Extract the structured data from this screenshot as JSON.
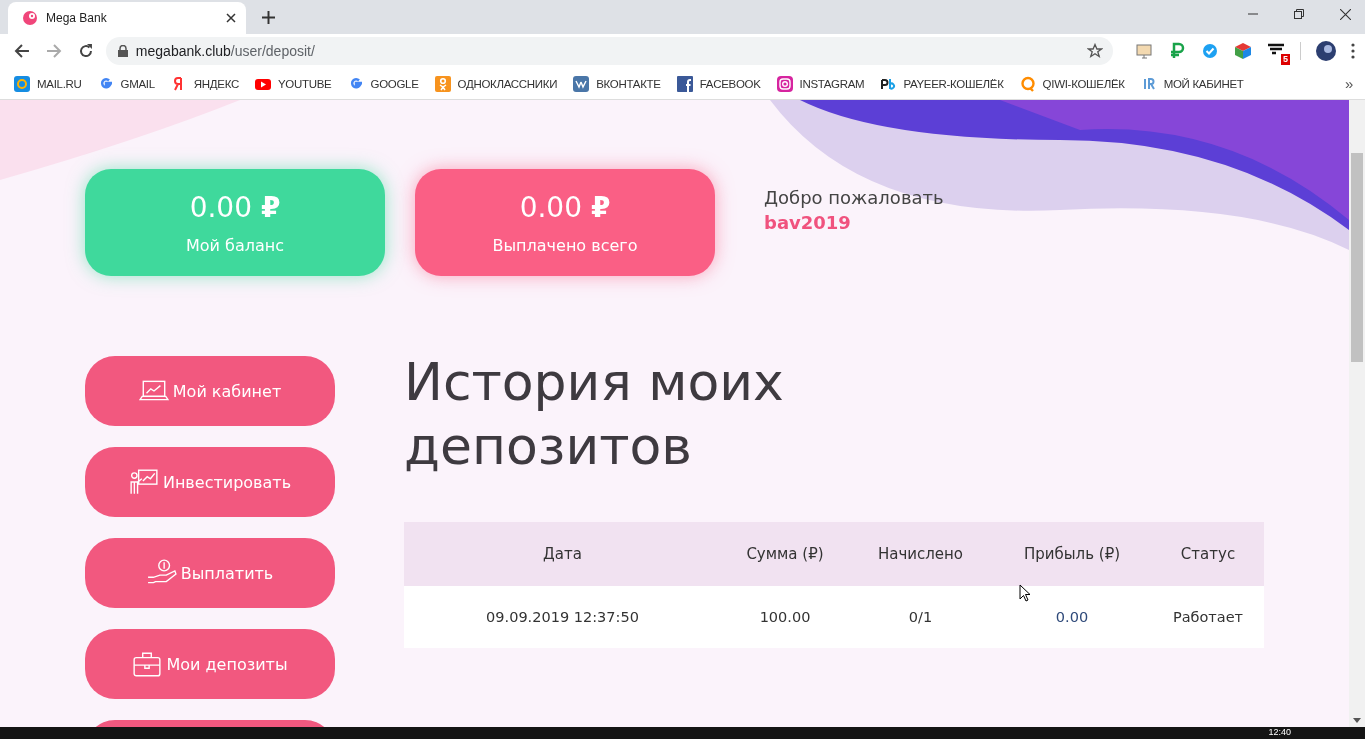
{
  "browser": {
    "tab_title": "Mega Bank",
    "url_host": "megabank.club",
    "url_path": "/user/deposit/",
    "bookmarks": [
      "MAIL.RU",
      "GMAIL",
      "ЯНДЕКС",
      "YOUTUBE",
      "GOOGLE",
      "ОДНОКЛАССНИКИ",
      "ВКОНТАКТЕ",
      "FACEBOOK",
      "INSTAGRAM",
      "PAYEER-КОШЕЛЁК",
      "QIWI-КОШЕЛЁК",
      "МОЙ КАБИНЕТ"
    ],
    "more_bookmarks": "»",
    "extension_badge": "5"
  },
  "stats": [
    {
      "amount": "0.00",
      "currency": "₽",
      "label": "Мой баланс",
      "color": "#3fd99c"
    },
    {
      "amount": "0.00",
      "currency": "₽",
      "label": "Выплачено всего",
      "color": "#fa5f85"
    }
  ],
  "welcome": {
    "greeting": "Добро пожаловать",
    "username": "bav2019"
  },
  "menu": [
    "Мой кабинет",
    "Инвестировать",
    "Выплатить",
    "Мои депозиты"
  ],
  "heading": "История моих депозитов",
  "table": {
    "columns": [
      "Дата",
      "Сумма (₽)",
      "Начислено",
      "Прибыль (₽)",
      "Статус"
    ],
    "rows": [
      [
        "09.09.2019 12:37:50",
        "100.00",
        "0/1",
        "0.00",
        "Работает"
      ]
    ]
  },
  "taskbar": {
    "clock": "12:40"
  }
}
